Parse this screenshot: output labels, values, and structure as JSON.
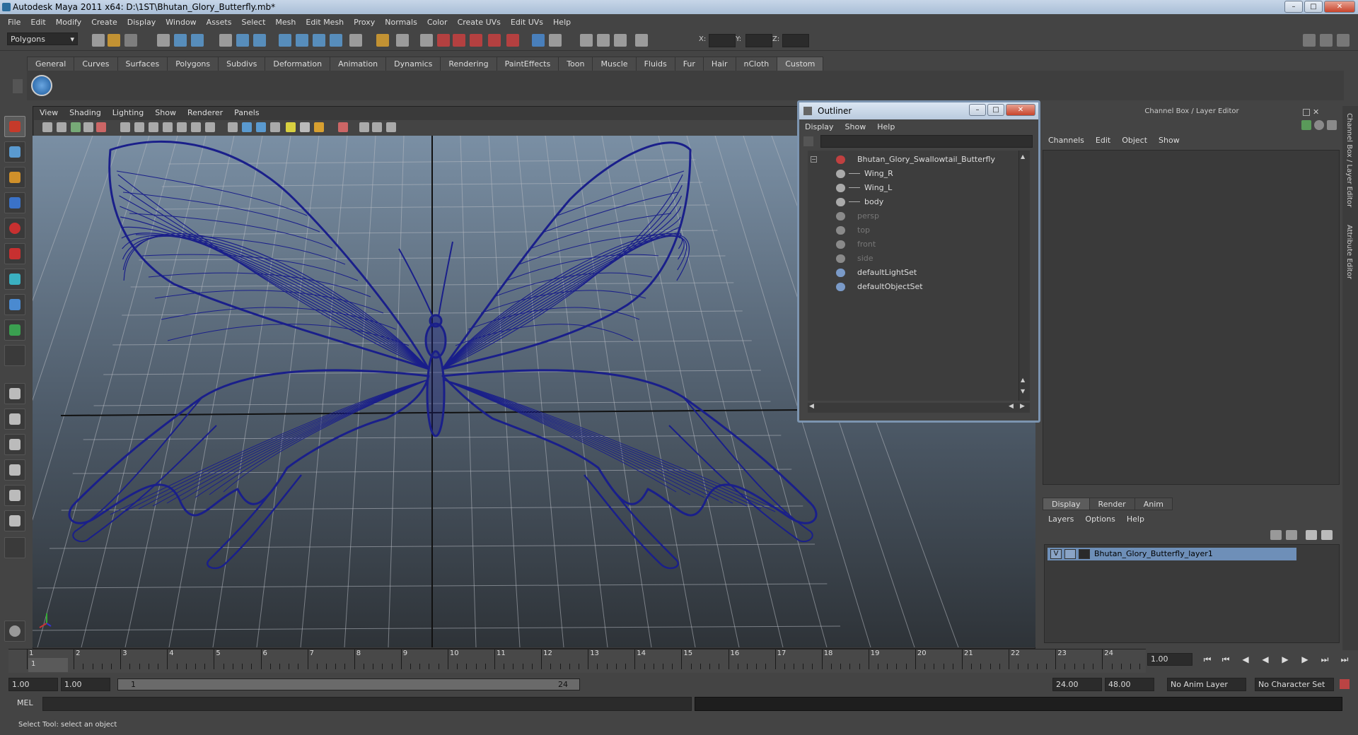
{
  "window": {
    "title": "Autodesk Maya 2011 x64: D:\\1ST\\Bhutan_Glory_Butterfly.mb*"
  },
  "menubar": [
    "File",
    "Edit",
    "Modify",
    "Create",
    "Display",
    "Window",
    "Assets",
    "Select",
    "Mesh",
    "Edit Mesh",
    "Proxy",
    "Normals",
    "Color",
    "Create UVs",
    "Edit UVs",
    "Help"
  ],
  "statusline": {
    "mode": "Polygons",
    "x_label": "X:",
    "y_label": "Y:",
    "z_label": "Z:"
  },
  "shelf_tabs": [
    "General",
    "Curves",
    "Surfaces",
    "Polygons",
    "Subdivs",
    "Deformation",
    "Animation",
    "Dynamics",
    "Rendering",
    "PaintEffects",
    "Toon",
    "Muscle",
    "Fluids",
    "Fur",
    "Hair",
    "nCloth",
    "Custom"
  ],
  "shelf_active": "Custom",
  "viewport": {
    "menu": [
      "View",
      "Shading",
      "Lighting",
      "Show",
      "Renderer",
      "Panels"
    ],
    "wire_color": "#1a1f8a"
  },
  "outliner": {
    "title": "Outliner",
    "menu": [
      "Display",
      "Show",
      "Help"
    ],
    "items": [
      {
        "label": "Bhutan_Glory_Swallowtail_Butterfly",
        "indent": 0,
        "dim": false,
        "icon": "group-icon"
      },
      {
        "label": "Wing_R",
        "indent": 1,
        "dim": false,
        "icon": "mesh-icon"
      },
      {
        "label": "Wing_L",
        "indent": 1,
        "dim": false,
        "icon": "mesh-icon"
      },
      {
        "label": "body",
        "indent": 1,
        "dim": false,
        "icon": "mesh-icon"
      },
      {
        "label": "persp",
        "indent": 0,
        "dim": true,
        "icon": "camera-icon"
      },
      {
        "label": "top",
        "indent": 0,
        "dim": true,
        "icon": "camera-icon"
      },
      {
        "label": "front",
        "indent": 0,
        "dim": true,
        "icon": "camera-icon"
      },
      {
        "label": "side",
        "indent": 0,
        "dim": true,
        "icon": "camera-icon"
      },
      {
        "label": "defaultLightSet",
        "indent": 0,
        "dim": false,
        "icon": "set-icon"
      },
      {
        "label": "defaultObjectSet",
        "indent": 0,
        "dim": false,
        "icon": "set-icon"
      }
    ]
  },
  "channel_box": {
    "title": "Channel Box / Layer Editor",
    "menu": [
      "Channels",
      "Edit",
      "Object",
      "Show"
    ]
  },
  "layer_editor": {
    "tabs": [
      "Display",
      "Render",
      "Anim"
    ],
    "active_tab": "Display",
    "menu": [
      "Layers",
      "Options",
      "Help"
    ],
    "layer": {
      "visible": "V",
      "name": "Bhutan_Glory_Butterfly_layer1"
    }
  },
  "side_tabs": [
    "Channel Box / Layer Editor",
    "Attribute Editor"
  ],
  "timeline": {
    "ticks": [
      "1",
      "2",
      "3",
      "4",
      "5",
      "6",
      "7",
      "8",
      "9",
      "10",
      "11",
      "12",
      "13",
      "14",
      "15",
      "16",
      "17",
      "18",
      "19",
      "20",
      "21",
      "22",
      "23",
      "24"
    ],
    "current_frame": "1.00",
    "current_marker": "1"
  },
  "range": {
    "start_outer": "1.00",
    "start_inner": "1.00",
    "slider_start": "1",
    "slider_end": "24",
    "end_inner": "24.00",
    "end_outer": "48.00",
    "anim_layer": "No Anim Layer",
    "char_set": "No Character Set"
  },
  "mel": {
    "label": "MEL"
  },
  "help_line": "Select Tool: select an object"
}
